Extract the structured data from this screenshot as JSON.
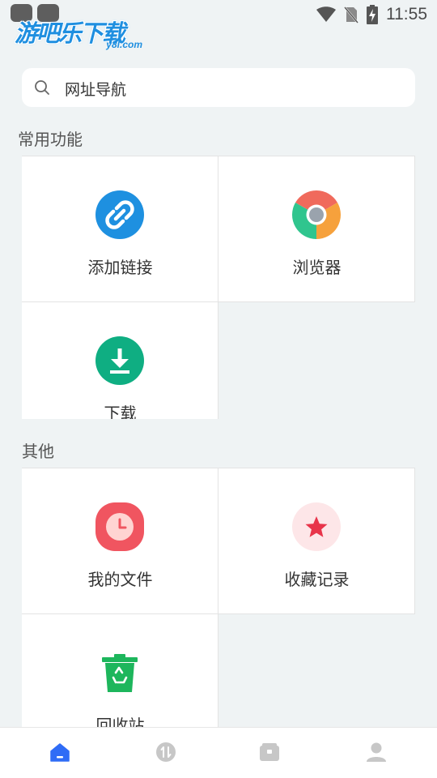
{
  "status_bar": {
    "time": "11:55",
    "icons": [
      "wifi-icon",
      "no-sim-icon",
      "battery-charging-icon"
    ]
  },
  "watermark": {
    "text": "游吧乐下载",
    "sub": "y8l.com"
  },
  "search": {
    "placeholder": "网址导航",
    "icon": "search-icon"
  },
  "sections": {
    "common": {
      "title": "常用功能",
      "items": [
        {
          "label": "添加链接",
          "icon": "link-icon",
          "color": "#1e90e0"
        },
        {
          "label": "浏览器",
          "icon": "chrome-icon",
          "color": "#f06a5c"
        },
        {
          "label": "下载",
          "icon": "download-icon",
          "color": "#0fae82"
        }
      ]
    },
    "other": {
      "title": "其他",
      "items": [
        {
          "label": "我的文件",
          "icon": "clock-icon",
          "color": "#f05560"
        },
        {
          "label": "收藏记录",
          "icon": "star-icon",
          "color": "#e8344a"
        },
        {
          "label": "回收站",
          "icon": "recycle-bin-icon",
          "color": "#1db65c"
        }
      ]
    }
  },
  "bottom_nav": {
    "items": [
      "home-icon",
      "transfer-icon",
      "box-icon",
      "profile-icon"
    ],
    "active_color": "#2f6cf6",
    "inactive_color": "#c7c7c7"
  }
}
